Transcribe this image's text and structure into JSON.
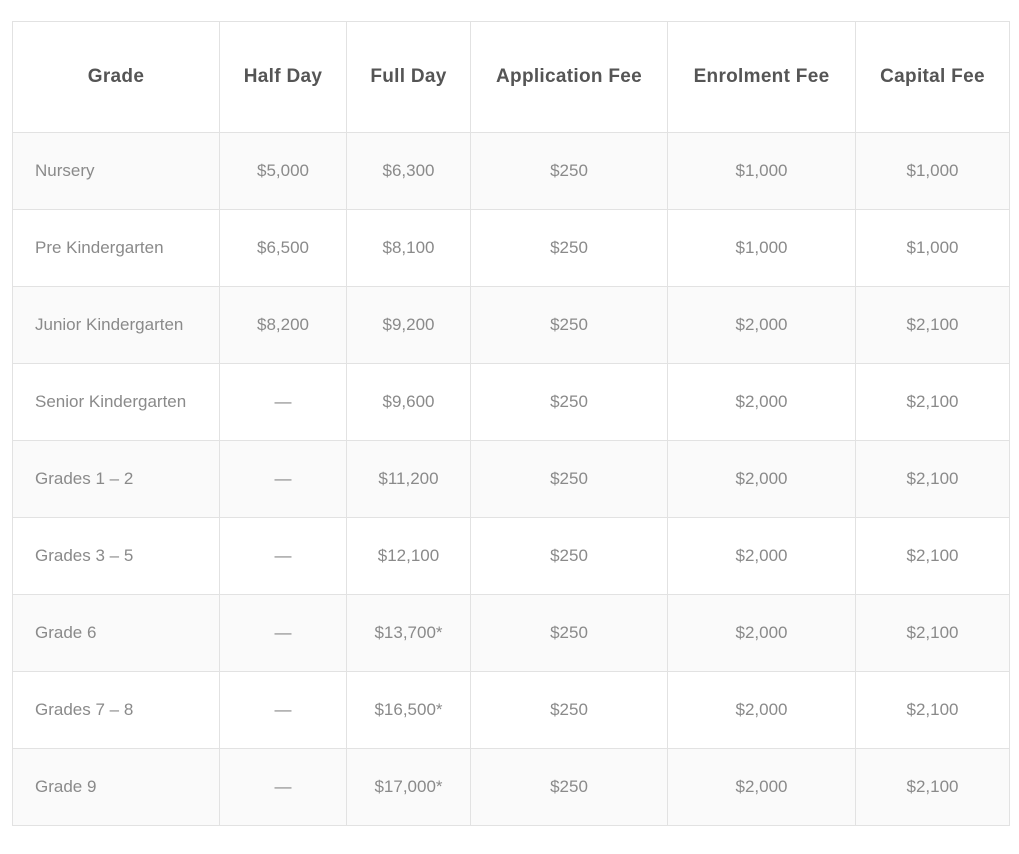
{
  "table": {
    "headers": [
      "Grade",
      "Half Day",
      "Full Day",
      "Application Fee",
      "Enrolment Fee",
      "Capital Fee"
    ],
    "rows": [
      [
        "Nursery",
        "$5,000",
        "$6,300",
        "$250",
        "$1,000",
        "$1,000"
      ],
      [
        "Pre Kindergarten",
        "$6,500",
        "$8,100",
        "$250",
        "$1,000",
        "$1,000"
      ],
      [
        "Junior Kindergarten",
        "$8,200",
        "$9,200",
        "$250",
        "$2,000",
        "$2,100"
      ],
      [
        "Senior Kindergarten",
        "—",
        "$9,600",
        "$250",
        "$2,000",
        "$2,100"
      ],
      [
        "Grades 1 – 2",
        "—",
        "$11,200",
        "$250",
        "$2,000",
        "$2,100"
      ],
      [
        "Grades 3 – 5",
        "—",
        "$12,100",
        "$250",
        "$2,000",
        "$2,100"
      ],
      [
        "Grade 6",
        "—",
        "$13,700*",
        "$250",
        "$2,000",
        "$2,100"
      ],
      [
        "Grades 7 – 8",
        "—",
        "$16,500*",
        "$250",
        "$2,000",
        "$2,100"
      ],
      [
        "Grade 9",
        "—",
        "$17,000*",
        "$250",
        "$2,000",
        "$2,100"
      ]
    ]
  }
}
